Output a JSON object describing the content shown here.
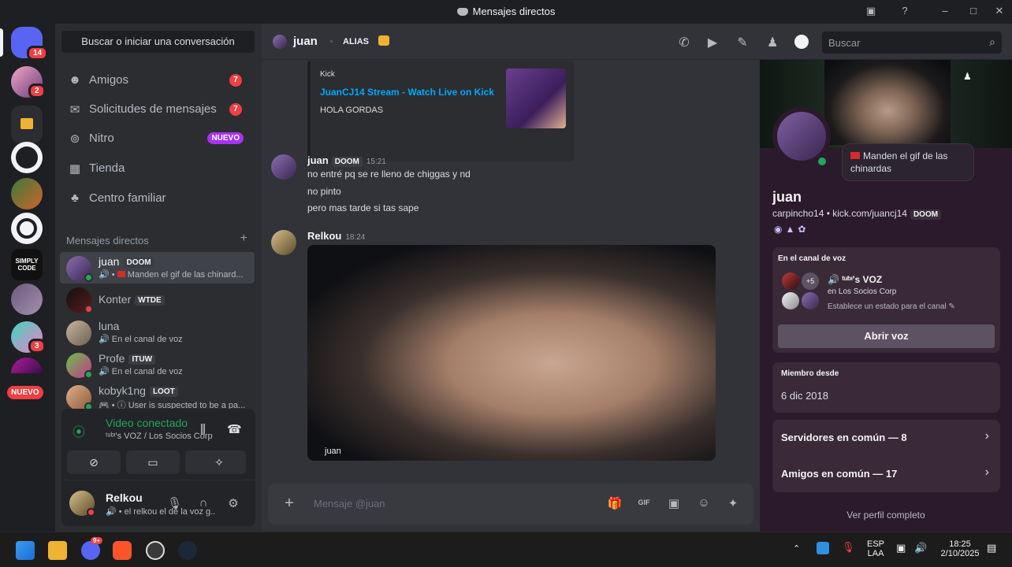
{
  "window": {
    "title": "Mensajes directos"
  },
  "rail": {
    "home_badge": "14",
    "server2_badge": "2",
    "server9_badge": "3",
    "nuevo_label": "NUEVO"
  },
  "sidebar": {
    "search_label": "Buscar o iniciar una conversación",
    "nav": [
      {
        "label": "Amigos",
        "icon": "friends-icon",
        "count": "7"
      },
      {
        "label": "Solicitudes de mensajes",
        "icon": "mail-icon",
        "count": "7"
      },
      {
        "label": "Nitro",
        "icon": "nitro-icon",
        "badge": "NUEVO"
      },
      {
        "label": "Tienda",
        "icon": "shop-icon"
      },
      {
        "label": "Centro familiar",
        "icon": "family-icon"
      }
    ],
    "dm_header": "Mensajes directos",
    "dms": [
      {
        "name": "juan",
        "tag": "DOOM",
        "sub": "Manden el gif de las chinard..."
      },
      {
        "name": "Konter",
        "tag": "WTDE",
        "sub": ""
      },
      {
        "name": "luna",
        "tag": "",
        "sub": "En el canal de voz"
      },
      {
        "name": "Profe",
        "tag": "ITUW",
        "sub": "En el canal de voz"
      },
      {
        "name": "kobyk1ng",
        "tag": "LOOT",
        "sub": "• ⓘ User is suspected to be a pa..."
      }
    ]
  },
  "voice_panel": {
    "title": "Video conectado",
    "subtitle": "ᵗᵘᵇᶦ's VOZ / Los Socios Corp"
  },
  "user_panel": {
    "name": "Relkou",
    "status": "• el relkou el de la voz g..."
  },
  "chat": {
    "recipient": "juan",
    "alias_label": "ALIAS",
    "embed": {
      "provider": "Kick",
      "title": "JuanCJ14 Stream - Watch Live on Kick",
      "description": "HOLA GORDAS"
    },
    "messages": [
      {
        "author": "juan",
        "tag": "DOOM",
        "time": "15:21",
        "lines": [
          "no entré pq se re lleno de chiggas y nd",
          "no pinto",
          "pero mas tarde si tas sape"
        ]
      },
      {
        "author": "Relkou",
        "time": "18:24",
        "video_label": "juan"
      }
    ],
    "composer_placeholder": "Mensaje @juan"
  },
  "header_search": {
    "placeholder": "Buscar"
  },
  "profile": {
    "status_bubble": "Manden el gif de las chinardas",
    "name": "juan",
    "handle": "carpincho14 • kick.com/juancj14",
    "tag": "DOOM",
    "voice_card": {
      "title": "En el canal de voz",
      "more_count": "+5",
      "channel": "ᵗᵘᵇᶦ's VOZ",
      "server": "en Los Socios Corp",
      "set_status": "Establece un estado para el canal",
      "open_button": "Abrir voz"
    },
    "member_since_title": "Miembro desde",
    "member_since": "6 dic 2018",
    "common_servers": "Servidores en común — 8",
    "common_friends": "Amigos en común — 17",
    "full_profile": "Ver perfil completo"
  },
  "taskbar": {
    "discord_badge": "9+",
    "lang_top": "ESP",
    "lang_bottom": "LAA",
    "time": "18:25",
    "date": "2/10/2025"
  }
}
